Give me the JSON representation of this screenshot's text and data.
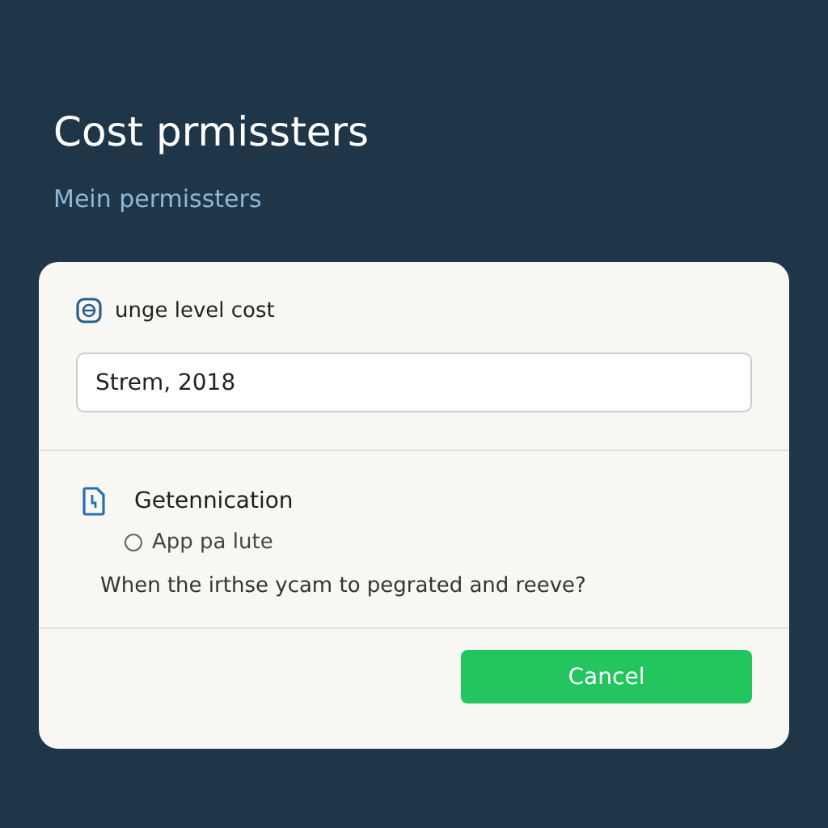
{
  "title": "Cost prmissters",
  "subtitle": "Mein permissters",
  "card": {
    "section_label": "unge level cost",
    "field": {
      "value": "Strem, 2018"
    },
    "section_heading": "Getennication",
    "radio": {
      "label": "App pa lute",
      "selected": false
    },
    "question": "When the irthse ycam to pegrated and reeve?",
    "button": "Cancel"
  }
}
